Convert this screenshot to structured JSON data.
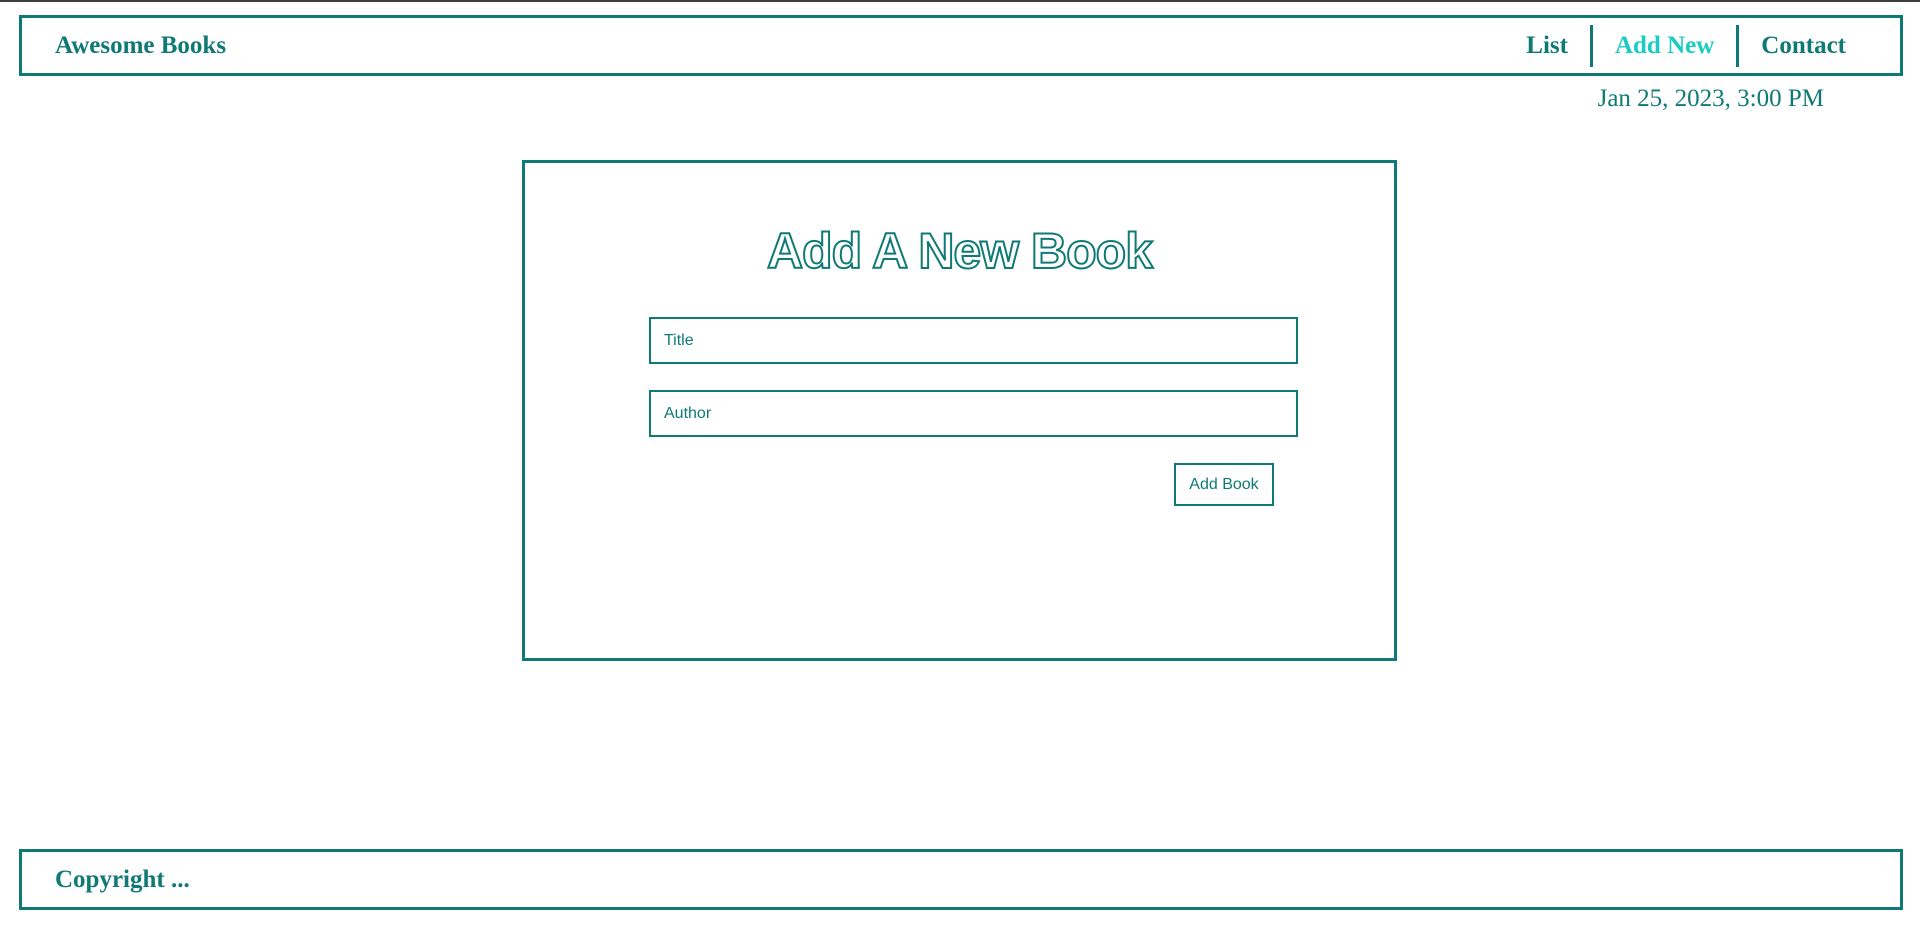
{
  "colors": {
    "primary": "#0f7a75",
    "active": "#19cdc4",
    "background": "#ffffff"
  },
  "header": {
    "brand": "Awesome Books",
    "nav": [
      {
        "label": "List",
        "active": false
      },
      {
        "label": "Add New",
        "active": true
      },
      {
        "label": "Contact",
        "active": false
      }
    ],
    "datetime": "Jan 25, 2023, 3:00 PM"
  },
  "form": {
    "title": "Add A New Book",
    "title_placeholder": "Title",
    "author_placeholder": "Author",
    "submit_label": "Add Book"
  },
  "footer": {
    "copyright": "Copyright ..."
  }
}
